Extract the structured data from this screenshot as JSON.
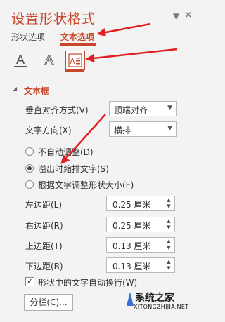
{
  "pane": {
    "title": "设置形状格式",
    "dropdown_arrow": "▼",
    "close": "✕"
  },
  "tabs": [
    {
      "label": "形状选项"
    },
    {
      "label": "文本选项"
    }
  ],
  "icon_buttons": [
    {
      "name": "text-fill-outline-icon",
      "glyph": "A"
    },
    {
      "name": "text-effects-icon",
      "glyph": "A"
    },
    {
      "name": "textbox-icon",
      "glyph": "A≡"
    }
  ],
  "section": {
    "toggle": "◢",
    "label": "文本框"
  },
  "vertical_align": {
    "label": "垂直对齐方式(V)",
    "value": "顶端对齐"
  },
  "text_direction": {
    "label": "文字方向(X)",
    "value": "横排"
  },
  "autofit": [
    {
      "label": "不自动调整(D)",
      "selected": false
    },
    {
      "label": "溢出时缩排文字(S)",
      "selected": true
    },
    {
      "label": "根据文字调整形状大小(F)",
      "selected": false
    }
  ],
  "margins": [
    {
      "label": "左边距(L)",
      "value": "0.25 厘米"
    },
    {
      "label": "右边距(R)",
      "value": "0.25 厘米"
    },
    {
      "label": "上边距(T)",
      "value": "0.13 厘米"
    },
    {
      "label": "下边距(B)",
      "value": "0.13 厘米"
    }
  ],
  "wrap_text": {
    "label": "形状中的文字自动换行(W)",
    "checked": true,
    "mark": "✓"
  },
  "columns_button": {
    "label": "分栏(C)..."
  },
  "watermark": {
    "name": "系统之家",
    "sub": "XITONGZHIJIA.NET"
  },
  "colors": {
    "accent": "#c8472b",
    "arrow": "#e02020",
    "background": "#f3f3f3"
  }
}
